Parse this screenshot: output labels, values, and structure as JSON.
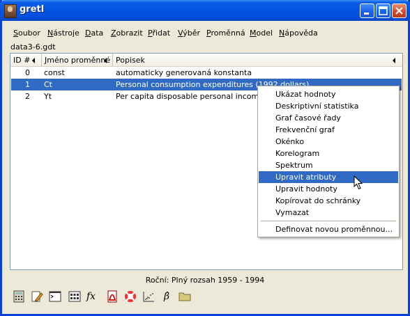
{
  "window": {
    "title": "gretl"
  },
  "menubar": {
    "items": [
      {
        "label": "Soubor",
        "ul": "S",
        "rest": "oubor"
      },
      {
        "label": "Nástroje",
        "ul": "N",
        "rest": "ástroje"
      },
      {
        "label": "Data",
        "ul": "D",
        "rest": "ata"
      },
      {
        "label": "Zobrazit",
        "ul": "Z",
        "rest": "obrazit"
      },
      {
        "label": "Přidat",
        "ul": "P",
        "rest": "řidat"
      },
      {
        "label": "Výběr",
        "ul": "V",
        "rest": "ýběr"
      },
      {
        "label": "Proměnná",
        "ul": "P",
        "rest": "roměnná"
      },
      {
        "label": "Model",
        "ul": "M",
        "rest": "odel"
      },
      {
        "label": "Nápověda",
        "ul": "N",
        "rest": "ápověda"
      }
    ]
  },
  "dataset": {
    "filename": "data3-6.gdt"
  },
  "table": {
    "columns": [
      "ID #",
      "Jméno proměnné",
      "Popisek"
    ],
    "rows": [
      {
        "id": "0",
        "name": "const",
        "label": "automaticky generovaná konstanta",
        "selected": false
      },
      {
        "id": "1",
        "name": "Ct",
        "label": "Personal consumption expenditures (1992 dollars)",
        "selected": true
      },
      {
        "id": "2",
        "name": "Yt",
        "label": "Per capita disposable personal income (1992 dollars)",
        "selected": false
      }
    ]
  },
  "status": {
    "text": "Roční: Plný rozsah 1959 - 1994"
  },
  "toolbar": {
    "icons": [
      "calculator-icon",
      "edit-icon",
      "terminal-icon",
      "session-icon",
      "function-icon",
      "pdf-icon",
      "help-icon",
      "scatter-plot-icon",
      "beta-icon",
      "folder-icon"
    ],
    "fx_label": "fx",
    "beta_label": "β̂"
  },
  "context_menu": {
    "items": [
      "Ukázat hodnoty",
      "Deskriptivní statistika",
      "Graf časové řady",
      "Frekvenční graf",
      "Okénko",
      "Korelogram",
      "Spektrum",
      "Upravit atributy",
      "Upravit hodnoty",
      "Kopírovat do schránky",
      "Vymazat",
      "Definovat novou proměnnou..."
    ],
    "highlighted_index": 7
  },
  "colors": {
    "title_bar": "#0554e3",
    "selection": "#316ac5",
    "window_bg": "#ece9d8"
  }
}
